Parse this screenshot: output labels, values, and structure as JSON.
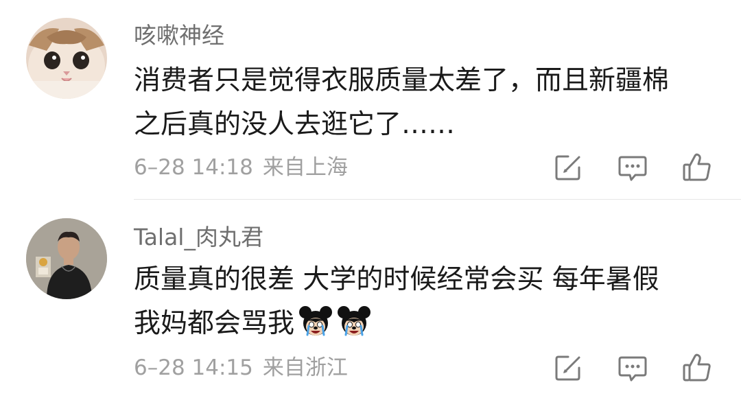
{
  "comments": [
    {
      "username": "咳嗽神经",
      "content_lines": [
        "消费者只是觉得衣服质量太差了，而且新疆棉",
        "之后真的没人去逛它了……"
      ],
      "timestamp": "6–28 14:18",
      "location": "来自上海",
      "avatar": "cat-avatar"
    },
    {
      "username": "Talal_肉丸君",
      "content_lines": [
        "质量真的很差 大学的时候经常会买 每年暑假",
        "我妈都会骂我"
      ],
      "emojis": [
        "crying-mickey-emoji",
        "crying-mickey-emoji"
      ],
      "timestamp": "6–28 14:15",
      "location": "来自浙江",
      "avatar": "person-avatar"
    }
  ],
  "actions": [
    "edit-icon",
    "reply-icon",
    "like-icon"
  ],
  "colors": {
    "username": "#6f6f6f",
    "content": "#1a1a1a",
    "meta": "#a0a0a0",
    "icon": "#7a7a7a",
    "divider": "#e6e6e6"
  }
}
